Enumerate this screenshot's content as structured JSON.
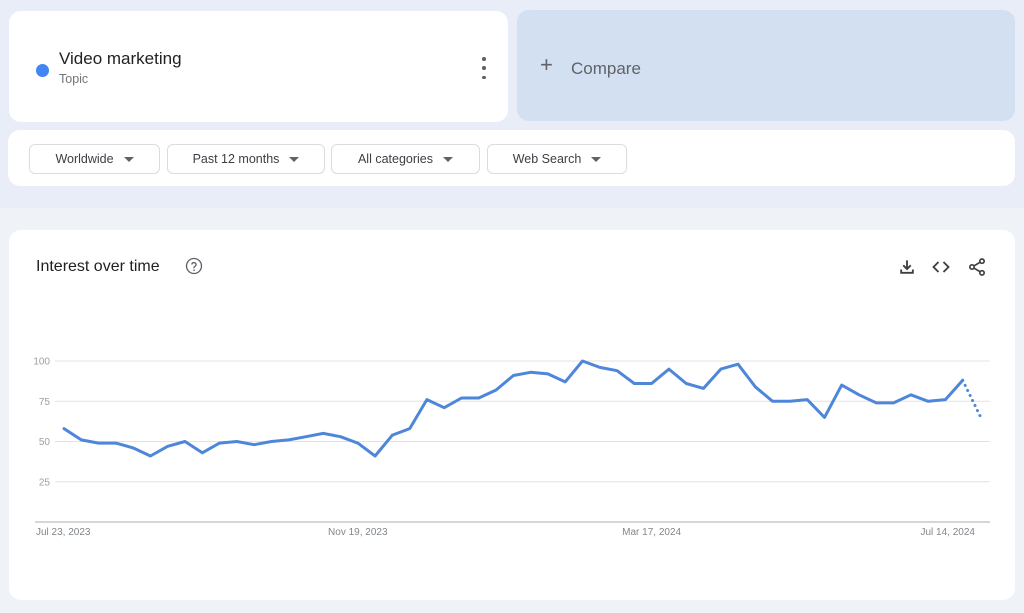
{
  "term": {
    "name": "Video marketing",
    "type": "Topic",
    "color": "#4285f4"
  },
  "compare": {
    "label": "Compare",
    "icon": "plus-icon"
  },
  "filters": [
    {
      "label": "Worldwide"
    },
    {
      "label": "Past 12 months"
    },
    {
      "label": "All categories"
    },
    {
      "label": "Web Search"
    }
  ],
  "chart_panel": {
    "title": "Interest over time",
    "actions": [
      "download-icon",
      "embed-code-icon",
      "share-icon"
    ]
  },
  "chart_data": {
    "type": "line",
    "title": "Interest over time",
    "xlabel": "",
    "ylabel": "",
    "ylim": [
      0,
      100
    ],
    "yticks": [
      25,
      50,
      75,
      100
    ],
    "grid": true,
    "x_tick_labels": [
      "Jul 23, 2023",
      "Nov 19, 2023",
      "Mar 17, 2024",
      "Jul 14, 2024"
    ],
    "x_tick_indices": [
      0,
      17,
      34,
      51
    ],
    "series": [
      {
        "name": "Video marketing",
        "color": "#4e86d9",
        "values": [
          58,
          51,
          49,
          49,
          46,
          41,
          47,
          50,
          43,
          49,
          50,
          48,
          50,
          51,
          53,
          55,
          53,
          49,
          41,
          54,
          58,
          76,
          71,
          77,
          77,
          82,
          91,
          93,
          92,
          87,
          100,
          96,
          94,
          86,
          86,
          95,
          86,
          83,
          95,
          98,
          84,
          75,
          75,
          76,
          65,
          85,
          79,
          74,
          74,
          79,
          75,
          76,
          88,
          66
        ],
        "partial_last_point": true
      }
    ]
  }
}
